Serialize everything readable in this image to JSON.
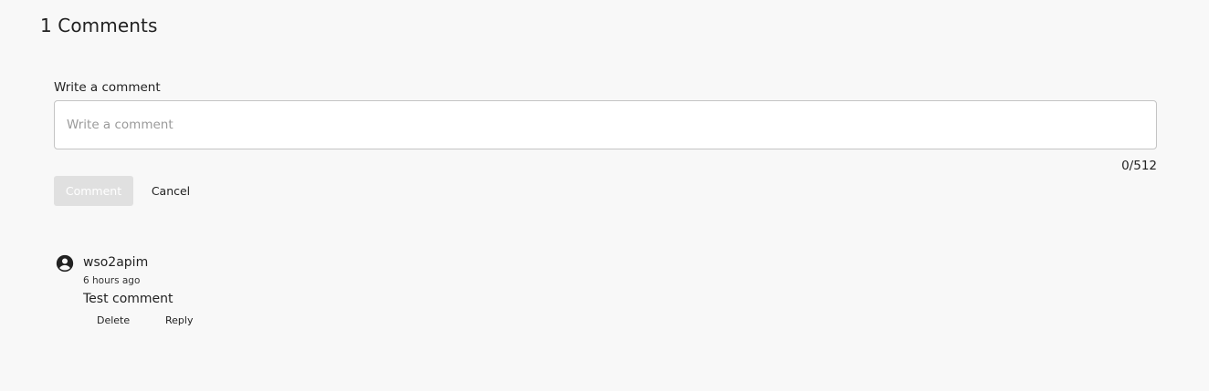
{
  "heading": "1 Comments",
  "form": {
    "label": "Write a comment",
    "placeholder": "Write a comment",
    "value": "",
    "counter": "0/512",
    "submit_label": "Comment",
    "cancel_label": "Cancel"
  },
  "comments": [
    {
      "avatar_icon": "account-circle-icon",
      "author": "wso2apim",
      "time": "6 hours ago",
      "text": "Test comment",
      "delete_label": "Delete",
      "reply_label": "Reply"
    }
  ],
  "colors": {
    "background": "#f8f8f8",
    "disabled_button": "#e0e0e0",
    "input_border": "#c4c4c4"
  }
}
